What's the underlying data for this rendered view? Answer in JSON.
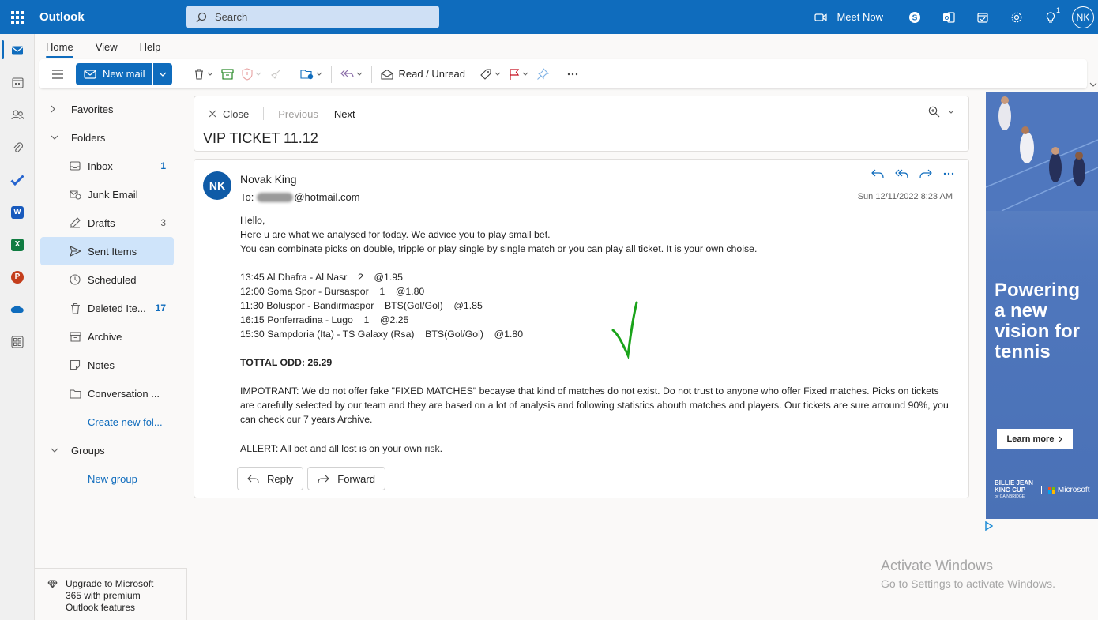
{
  "app": {
    "brand": "Outlook"
  },
  "search": {
    "placeholder": "Search"
  },
  "topbar": {
    "meet_now": "Meet Now",
    "tips_badge": "1",
    "user_initials": "NK"
  },
  "ribbon": {
    "tabs": [
      "Home",
      "View",
      "Help"
    ],
    "new_mail": "New mail",
    "read_unread": "Read / Unread"
  },
  "folders": {
    "favorites": "Favorites",
    "folders_label": "Folders",
    "items": [
      {
        "label": "Inbox",
        "count": "1",
        "icon": "inbox-icon"
      },
      {
        "label": "Junk Email",
        "count": "",
        "icon": "junk-icon"
      },
      {
        "label": "Drafts",
        "count": "3",
        "icon": "drafts-icon"
      },
      {
        "label": "Sent Items",
        "count": "",
        "icon": "sent-icon"
      },
      {
        "label": "Scheduled",
        "count": "",
        "icon": "clock-icon"
      },
      {
        "label": "Deleted Ite...",
        "count": "17",
        "icon": "trash-icon"
      },
      {
        "label": "Archive",
        "count": "",
        "icon": "archive-icon"
      },
      {
        "label": "Notes",
        "count": "",
        "icon": "notes-icon"
      },
      {
        "label": "Conversation ...",
        "count": "",
        "icon": "folder-icon"
      }
    ],
    "create_new": "Create new fol...",
    "groups": "Groups",
    "new_group": "New group"
  },
  "upgrade": {
    "text_1": "Upgrade to Microsoft",
    "text_2": "365 with premium",
    "text_3": "Outlook features"
  },
  "reading": {
    "close": "Close",
    "previous": "Previous",
    "next": "Next",
    "subject": "VIP TICKET 11.12"
  },
  "message": {
    "initials": "NK",
    "sender": "Novak King",
    "to_label": "To:",
    "to_domain": "@hotmail.com",
    "date": "Sun 12/11/2022 8:23 AM",
    "lines": {
      "l1": "Hello,",
      "l2": "Here u are what we analysed for today. We advice you to play small bet.",
      "l3": "You can combinate picks on double, tripple or play single by single match or you can play all ticket. It is your own choise.",
      "m1": "13:45 Al Dhafra - Al Nasr    2    @1.95",
      "m2": "12:00 Soma Spor - Bursaspor    1    @1.80",
      "m3": "11:30 Boluspor - Bandirmaspor    BTS(Gol/Gol)    @1.85",
      "m4": "16:15 Ponferradina - Lugo    1    @2.25",
      "m5": "15:30 Sampdoria (Ita) - TS Galaxy (Rsa)    BTS(Gol/Gol)    @1.80",
      "total": "TOTTAL ODD: 26.29",
      "important": "IMPOTRANT: We do not offer fake \"FIXED MATCHES\" becayse that kind of matches do not exist. Do not trust to anyone who offer Fixed matches. Picks on tickets are carefully selected by our team and they are based on a lot of analysis and following statistics abouth matches and players. Our tickets are sure arround 90%, you can check our 7 years Archive.",
      "allert": "ALLERT: All bet and all lost is on your own risk."
    },
    "reply": "Reply",
    "forward": "Forward"
  },
  "ad": {
    "headline_1": "Powering",
    "headline_2": "a new",
    "headline_3": "vision for",
    "headline_4": "tennis",
    "cta": "Learn more",
    "logo_1": "BILLIE JEAN",
    "logo_2": "KING CUP",
    "logo_3": "by GAINBRIDGE",
    "partner": "Microsoft"
  },
  "watermark": {
    "line1": "Activate Windows",
    "line2": "Go to Settings to activate Windows."
  }
}
